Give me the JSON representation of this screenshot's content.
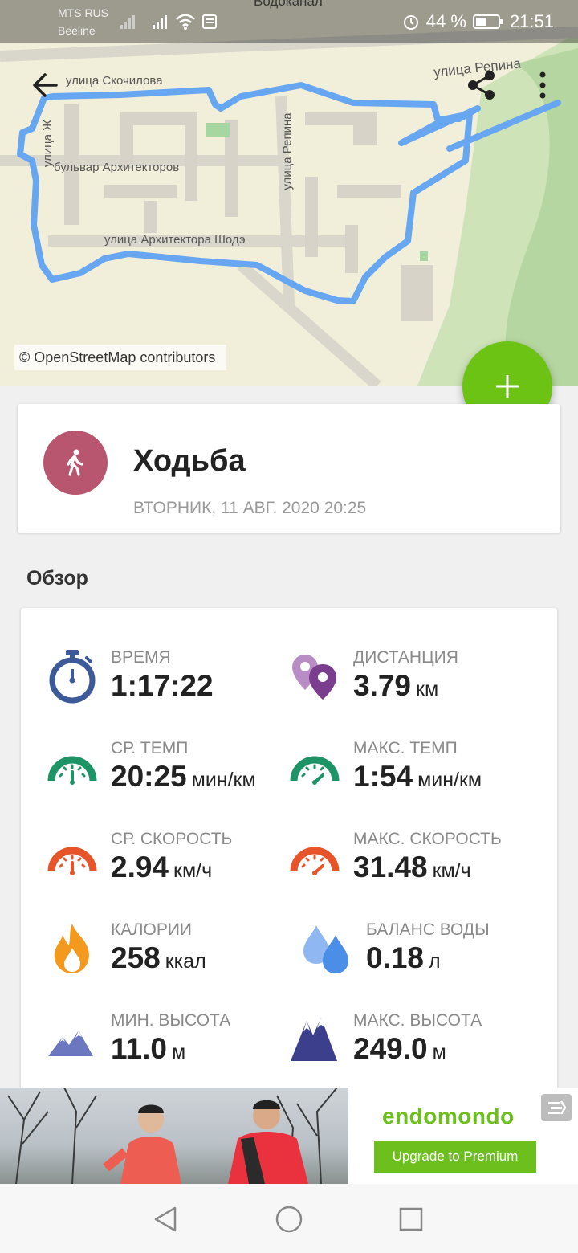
{
  "status_bar": {
    "carrier_1": "MTS RUS",
    "carrier_2": "Beeline",
    "battery_percent": "44 %",
    "time": "21:51",
    "icons": [
      "signal-icon",
      "signal-icon",
      "wifi-icon",
      "sms-icon",
      "alarm-icon",
      "battery-icon"
    ]
  },
  "map": {
    "attribution": "© OpenStreetMap contributors",
    "street_labels": [
      "Водоканал",
      "улица Репина",
      "улица Скочилова",
      "бульвар Архитекторов",
      "улица Репина",
      "улица Архитектора Шодэ",
      "улица Ж"
    ],
    "route_color": "#67a6f0"
  },
  "toolbar": {
    "back_icon": "arrow-back-icon",
    "share_icon": "share-icon",
    "more_icon": "more-vert-icon"
  },
  "fab": {
    "icon": "plus-icon",
    "color": "#6cc314"
  },
  "workout": {
    "sport": "Ходьба",
    "date": "ВТОРНИК, 11 АВГ. 2020 20:25",
    "sport_icon": "walking-person-icon",
    "avatar_color": "#b9566f"
  },
  "overview": {
    "title": "Обзор",
    "stats": [
      {
        "label": "ВРЕМЯ",
        "value": "1:17:22",
        "unit": "",
        "icon": "stopwatch-icon",
        "color": "#3d5a98"
      },
      {
        "label": "ДИСТАНЦИЯ",
        "value": "3.79",
        "unit": "км",
        "icon": "map-pins-icon",
        "color": "#7b3d8e"
      },
      {
        "label": "СР. ТЕМП",
        "value": "20:25",
        "unit": "мин/км",
        "icon": "pace-gauge-icon",
        "color": "#1d9466"
      },
      {
        "label": "МАКС. ТЕМП",
        "value": "1:54",
        "unit": "мин/км",
        "icon": "pace-gauge-icon",
        "color": "#1d9466"
      },
      {
        "label": "СР. СКОРОСТЬ",
        "value": "2.94",
        "unit": "км/ч",
        "icon": "speed-gauge-icon",
        "color": "#e8542a"
      },
      {
        "label": "МАКС. СКОРОСТЬ",
        "value": "31.48",
        "unit": "км/ч",
        "icon": "speed-gauge-icon",
        "color": "#e8542a"
      },
      {
        "label": "КАЛОРИИ",
        "value": "258",
        "unit": "ккал",
        "icon": "flame-icon",
        "color": "#f39a1e"
      },
      {
        "label": "БАЛАНС ВОДЫ",
        "value": "0.18",
        "unit": "л",
        "icon": "water-drops-icon",
        "color": "#4a8ee8"
      },
      {
        "label": "МИН. ВЫСОТА",
        "value": "11.0",
        "unit": "м",
        "icon": "mountain-icon",
        "color": "#6b78bf"
      },
      {
        "label": "МАКС. ВЫСОТА",
        "value": "249.0",
        "unit": "м",
        "icon": "mountain-icon",
        "color": "#3b3f8c"
      }
    ]
  },
  "ad": {
    "brand": "endomondo",
    "button_label": "Upgrade to Premium",
    "corner_icon": "premium-badge-icon"
  },
  "nav": {
    "back_icon": "nav-back-icon",
    "home_icon": "nav-home-icon",
    "recents_icon": "nav-recents-icon"
  }
}
